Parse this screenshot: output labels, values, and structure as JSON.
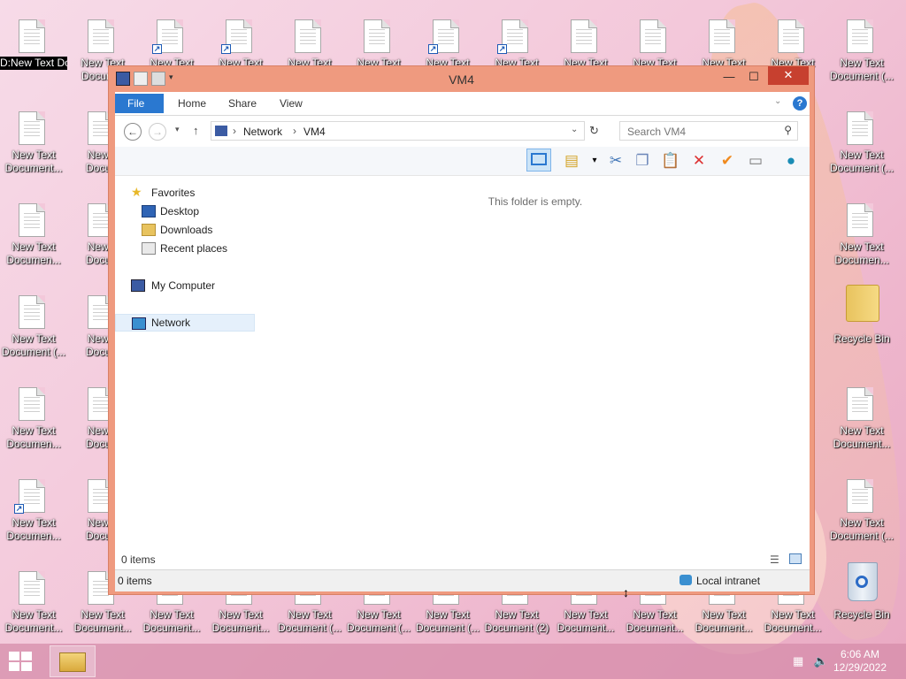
{
  "desktop": {
    "selected_icon_label": "D:New Text Document...",
    "top_row": [
      "New Text",
      "New Text",
      "New Text",
      "New Text",
      "New Text",
      "New Text",
      "New Text",
      "New Text",
      "New Text",
      "New Text",
      "New Text",
      "New Text"
    ],
    "top_row_second": [
      "Docum...",
      "Document (..."
    ],
    "left_col": [
      {
        "l1": "New Text",
        "l2": "Document..."
      },
      {
        "l1": "New Text",
        "l2": "Documen..."
      },
      {
        "l1": "New Text",
        "l2": "Document (..."
      },
      {
        "l1": "New Text",
        "l2": "Documen..."
      },
      {
        "l1": "New Text",
        "l2": "Documen..."
      }
    ],
    "col2": [
      {
        "l1": "New T",
        "l2": "Docum"
      },
      {
        "l1": "New T",
        "l2": "Docum"
      },
      {
        "l1": "New T",
        "l2": "Docum"
      },
      {
        "l1": "New T",
        "l2": "Docum"
      },
      {
        "l1": "New T",
        "l2": "Docum"
      }
    ],
    "right_col": [
      {
        "l1": "New Text",
        "l2": "Document (..."
      },
      {
        "l1": "New Text",
        "l2": "Documen..."
      },
      {
        "l1": "Recycle Bin",
        "l2": ""
      },
      {
        "l1": "New Text",
        "l2": "Document..."
      },
      {
        "l1": "New Text",
        "l2": "Document (..."
      }
    ],
    "bottom_row": [
      {
        "l1": "New Text",
        "l2": "Document..."
      },
      {
        "l1": "New Text",
        "l2": "Document..."
      },
      {
        "l1": "New Text",
        "l2": "Document..."
      },
      {
        "l1": "New Text",
        "l2": "Document..."
      },
      {
        "l1": "New Text",
        "l2": "Document (..."
      },
      {
        "l1": "New Text",
        "l2": "Document (..."
      },
      {
        "l1": "New Text",
        "l2": "Document (..."
      },
      {
        "l1": "New Text",
        "l2": "Document (2)"
      },
      {
        "l1": "New Text",
        "l2": "Document..."
      },
      {
        "l1": "New Text",
        "l2": "Document..."
      },
      {
        "l1": "New Text",
        "l2": "Document..."
      },
      {
        "l1": "New Text",
        "l2": "Document..."
      },
      {
        "l1": "Recycle Bin",
        "l2": ""
      }
    ]
  },
  "window": {
    "title": "VM4",
    "minimize": "—",
    "maximize": "☐",
    "close": "✕",
    "tabs": [
      "File",
      "Home",
      "Share",
      "View"
    ],
    "address": {
      "part1": "Network",
      "part2": "VM4"
    },
    "search_placeholder": "Search VM4",
    "nav": {
      "favorites": "Favorites",
      "desktop": "Desktop",
      "downloads": "Downloads",
      "recent": "Recent places",
      "computer": "My Computer",
      "network": "Network"
    },
    "empty_message": "This folder is empty.",
    "items_count": "0 items",
    "status_items": "0 items",
    "status_zone": "Local intranet"
  },
  "taskbar": {
    "time": "6:06 AM",
    "date": "12/29/2022"
  }
}
